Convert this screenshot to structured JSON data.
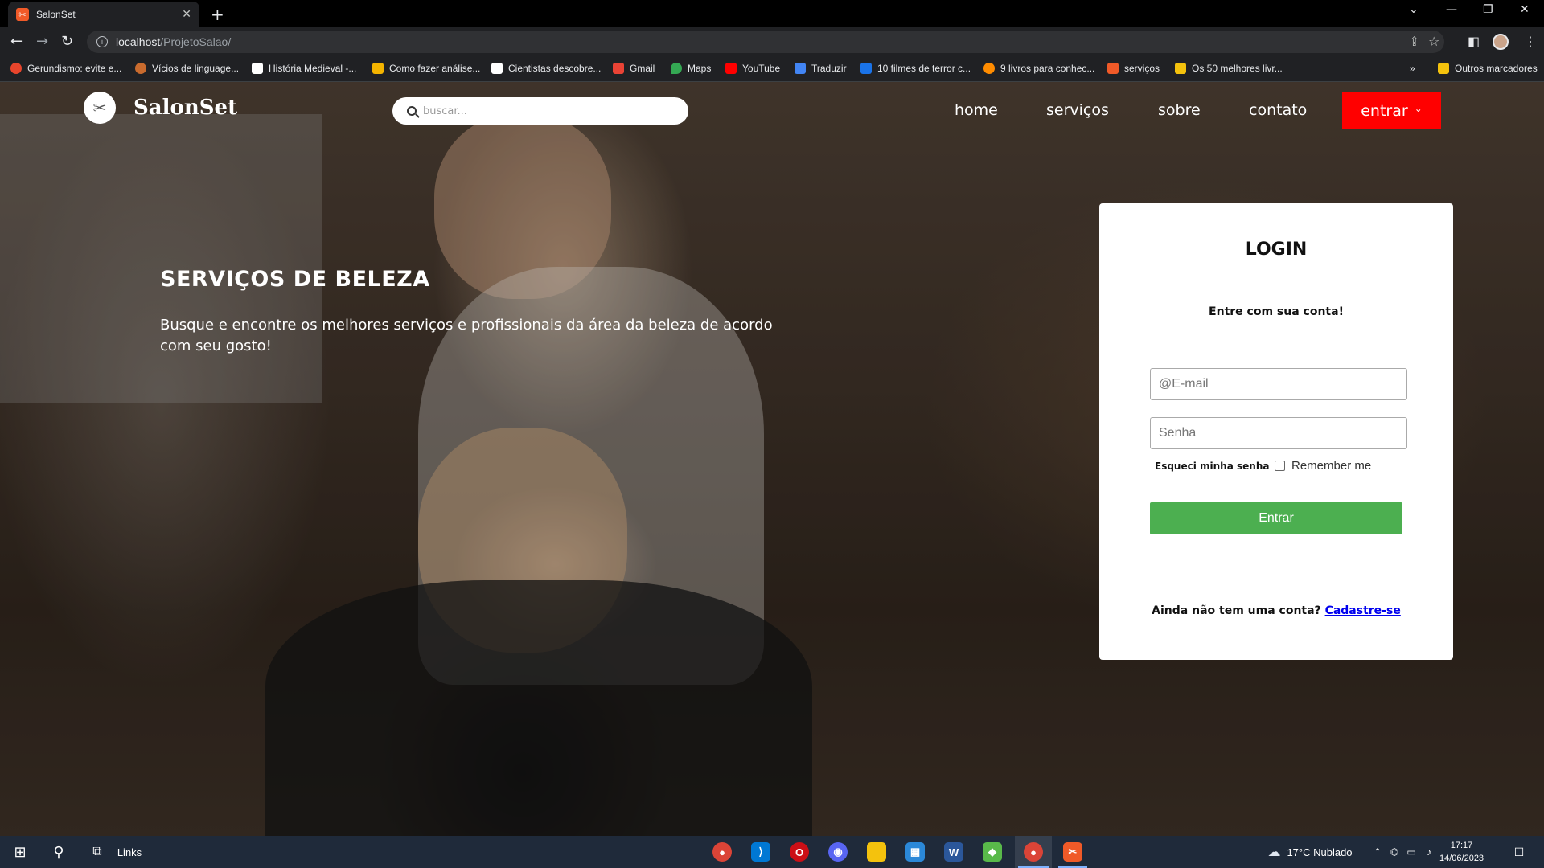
{
  "browser": {
    "tab_title": "SalonSet",
    "url_host": "localhost",
    "url_path": "/ProjetoSalao/",
    "bookmarks": [
      {
        "label": "Gerundismo: evite e...",
        "color": "#e8452c"
      },
      {
        "label": "Vícios de linguage...",
        "color": "#c96b2e"
      },
      {
        "label": "História Medieval -...",
        "color": "#ffffff"
      },
      {
        "label": "Como fazer análise...",
        "color": "#f4b400"
      },
      {
        "label": "Cientistas descobre...",
        "color": "#ffffff"
      },
      {
        "label": "Gmail",
        "color": "#ea4335"
      },
      {
        "label": "Maps",
        "color": "#34a853"
      },
      {
        "label": "YouTube",
        "color": "#ff0000"
      },
      {
        "label": "Traduzir",
        "color": "#4285f4"
      },
      {
        "label": "10 filmes de terror c...",
        "color": "#1a73e8"
      },
      {
        "label": "9 livros para conhec...",
        "color": "#ff8c00"
      },
      {
        "label": "serviços",
        "color": "#f05a28"
      },
      {
        "label": "Os 50 melhores livr...",
        "color": "#f4c20d"
      }
    ],
    "other_bookmarks": "Outros marcadores"
  },
  "header": {
    "brand": "SalonSet",
    "search_placeholder": "buscar...",
    "nav": {
      "home": "home",
      "servicos": "serviços",
      "sobre": "sobre",
      "contato": "contato"
    },
    "entrar_label": "entrar"
  },
  "hero": {
    "title": "SERVIÇOS DE BELEZA",
    "text": "Busque e encontre os melhores serviços e profissionais da área da beleza de acordo com seu gosto!"
  },
  "login": {
    "title": "LOGIN",
    "subtitle": "Entre com sua conta!",
    "email_at": "@",
    "email_placeholder": "E-mail",
    "password_placeholder": "Senha",
    "forgot": "Esqueci minha senha",
    "remember": "Remember me",
    "submit": "Entrar",
    "signup_prompt": "Ainda não tem uma conta?",
    "signup_link": "Cadastre-se"
  },
  "taskbar": {
    "links": "Links",
    "weather": "17°C  Nublado",
    "time": "17:17",
    "date": "14/06/2023"
  },
  "colors": {
    "entrar_button": "#ff0000",
    "submit_button": "#4caf50",
    "link": "#0000ee"
  }
}
